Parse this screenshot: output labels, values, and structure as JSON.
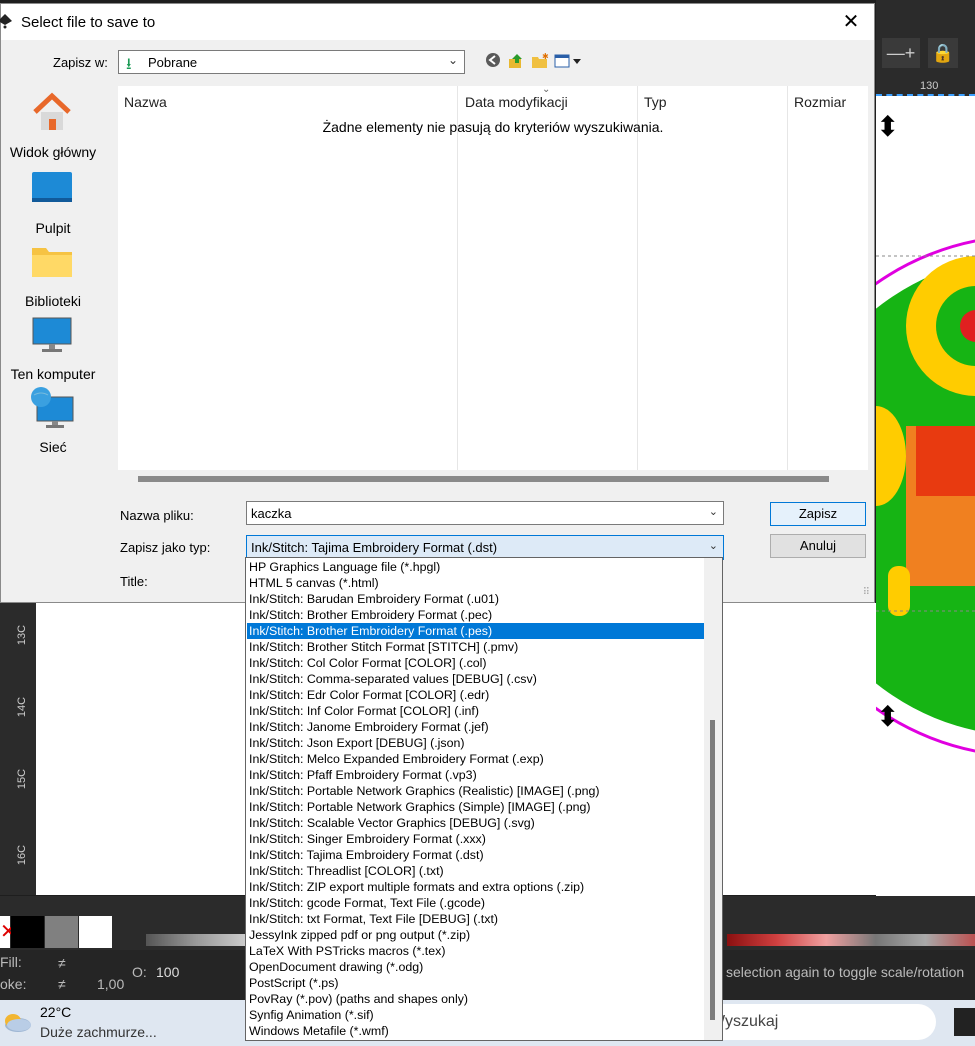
{
  "dialog": {
    "title": "Select file to save to",
    "close_symbol": "✕",
    "save_in_label": "Zapisz w:",
    "save_in_value": "Pobrane",
    "places": [
      {
        "label": "Widok główny",
        "icon": "home-icon"
      },
      {
        "label": "Pulpit",
        "icon": "desktop-icon"
      },
      {
        "label": "Biblioteki",
        "icon": "libraries-folder-icon"
      },
      {
        "label": "Ten komputer",
        "icon": "computer-icon"
      },
      {
        "label": "Sieć",
        "icon": "network-icon"
      }
    ],
    "columns": [
      "Nazwa",
      "Data modyfikacji",
      "Typ",
      "Rozmiar"
    ],
    "empty_message": "Żadne elementy nie pasują do kryteriów wyszukiwania.",
    "filename_label": "Nazwa pliku:",
    "filename_value": "kaczka",
    "filetype_label": "Zapisz jako typ:",
    "filetype_value": "Ink/Stitch: Tajima Embroidery Format (.dst)",
    "title_label": "Title:",
    "save_button": "Zapisz",
    "cancel_button": "Anuluj",
    "filetype_options": [
      "HP Graphics Language file (*.hpgl)",
      "HTML 5 canvas (*.html)",
      "Ink/Stitch: Barudan Embroidery Format (.u01)",
      "Ink/Stitch: Brother Embroidery Format (.pec)",
      "Ink/Stitch: Brother Embroidery Format (.pes)",
      "Ink/Stitch: Brother Stitch Format [STITCH] (.pmv)",
      "Ink/Stitch: Col Color Format [COLOR] (.col)",
      "Ink/Stitch: Comma-separated values [DEBUG] (.csv)",
      "Ink/Stitch: Edr Color Format [COLOR] (.edr)",
      "Ink/Stitch: Inf Color Format [COLOR] (.inf)",
      "Ink/Stitch: Janome Embroidery Format (.jef)",
      "Ink/Stitch: Json Export [DEBUG] (.json)",
      "Ink/Stitch: Melco Expanded Embroidery Format (.exp)",
      "Ink/Stitch: Pfaff Embroidery Format (.vp3)",
      "Ink/Stitch: Portable Network Graphics (Realistic) [IMAGE] (.png)",
      "Ink/Stitch: Portable Network Graphics (Simple) [IMAGE] (.png)",
      "Ink/Stitch: Scalable Vector Graphics [DEBUG] (.svg)",
      "Ink/Stitch: Singer Embroidery Format (.xxx)",
      "Ink/Stitch: Tajima Embroidery Format (.dst)",
      "Ink/Stitch: Threadlist [COLOR] (.txt)",
      "Ink/Stitch: ZIP export multiple formats and extra options (.zip)",
      "Ink/Stitch: gcode Format, Text File (.gcode)",
      "Ink/Stitch: txt Format, Text File [DEBUG] (.txt)",
      "JessyInk zipped pdf or png output (*.zip)",
      "LaTeX With PSTricks macros (*.tex)",
      "OpenDocument drawing (*.odg)",
      "PostScript (*.ps)",
      "PovRay (*.pov) (paths and shapes only)",
      "Synfig Animation (*.sif)",
      "Windows Metafile (*.wmf)"
    ],
    "selected_option_index": 4,
    "colors": {
      "selection": "#0078d7",
      "accent_border": "#0078d7"
    }
  },
  "background_app": {
    "ruler_top_label": "130",
    "ruler_left_labels": [
      "13C",
      "14C",
      "15C",
      "16C"
    ],
    "zoom_minus": "—",
    "zoom_plus": "+",
    "fill_label": "Fill:",
    "stroke_label": "oke:",
    "fill_value": "≠",
    "stroke_value": "≠",
    "stroke_width": "1,00",
    "opacity_label": "O:",
    "opacity_value": "100",
    "status_text": "selection again to toggle scale/rotation",
    "palette_colors": [
      "#000000",
      "#808080",
      "#ffffff"
    ]
  },
  "taskbar": {
    "weather_temp": "22°C",
    "weather_desc": "Duże zachmurze...",
    "search_placeholder": "Wyszukaj"
  }
}
